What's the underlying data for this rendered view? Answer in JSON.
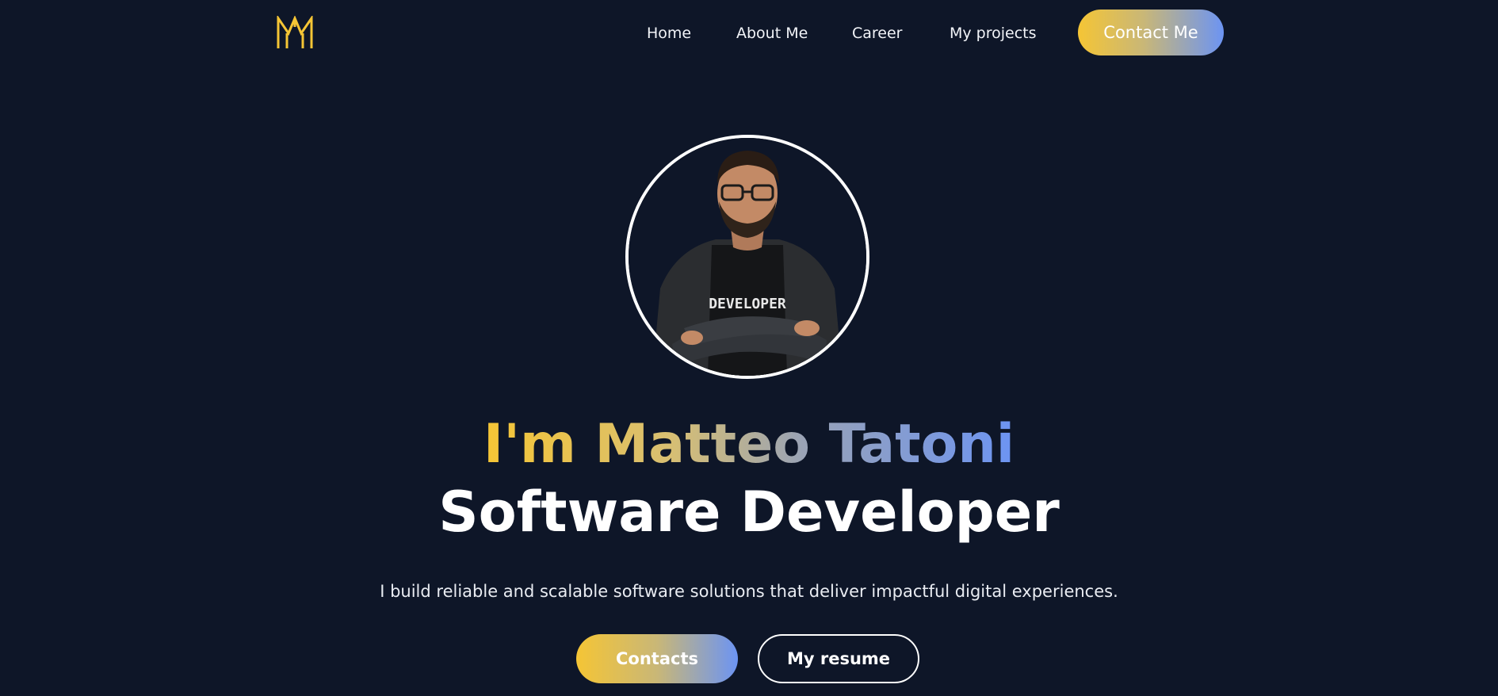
{
  "nav": {
    "logo_icon": "mm-monogram-icon",
    "links": [
      "Home",
      "About Me",
      "Career",
      "My projects"
    ],
    "contact_label": "Contact Me"
  },
  "hero": {
    "avatar_icon": "developer-portrait",
    "avatar_shirt_text": "DEVELOPER",
    "name": "I'm Matteo Tatoni",
    "role": "Software Developer",
    "tagline": "I build reliable and scalable software solutions that deliver impactful digital experiences.",
    "primary_button": "Contacts",
    "secondary_button": "My resume"
  },
  "colors": {
    "background": "#0e1628",
    "accent_yellow": "#f5c535",
    "accent_blue": "#6c94f3",
    "text": "#ffffff"
  }
}
